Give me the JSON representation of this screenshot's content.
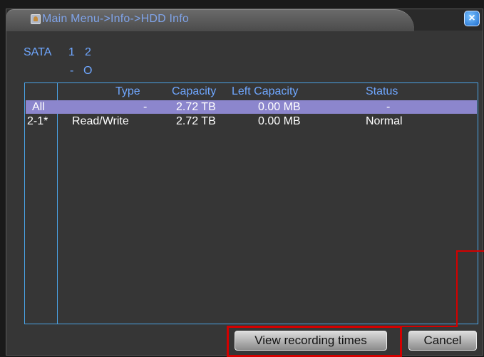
{
  "window": {
    "title": "Main Menu->Info->HDD Info",
    "close_glyph": "×",
    "title_icon": "user-icon"
  },
  "sata": {
    "label": "SATA",
    "ports": [
      "1",
      "2"
    ],
    "states": [
      "-",
      "O"
    ]
  },
  "table": {
    "headers": [
      "Type",
      "Capacity",
      "Left Capacity",
      "Status"
    ],
    "rows": [
      {
        "id": "All",
        "type": "-",
        "capacity": "2.72 TB",
        "left_capacity": "0.00 MB",
        "status": "-",
        "selected": true
      },
      {
        "id": "2-1*",
        "type": "Read/Write",
        "capacity": "2.72 TB",
        "left_capacity": "0.00 MB",
        "status": "Normal",
        "selected": false
      }
    ]
  },
  "buttons": {
    "view_recording_times": "View recording times",
    "cancel": "Cancel"
  },
  "colors": {
    "accent_blue": "#6fa7ff",
    "selection": "#8c86cd",
    "annotation_red": "#d40000"
  }
}
